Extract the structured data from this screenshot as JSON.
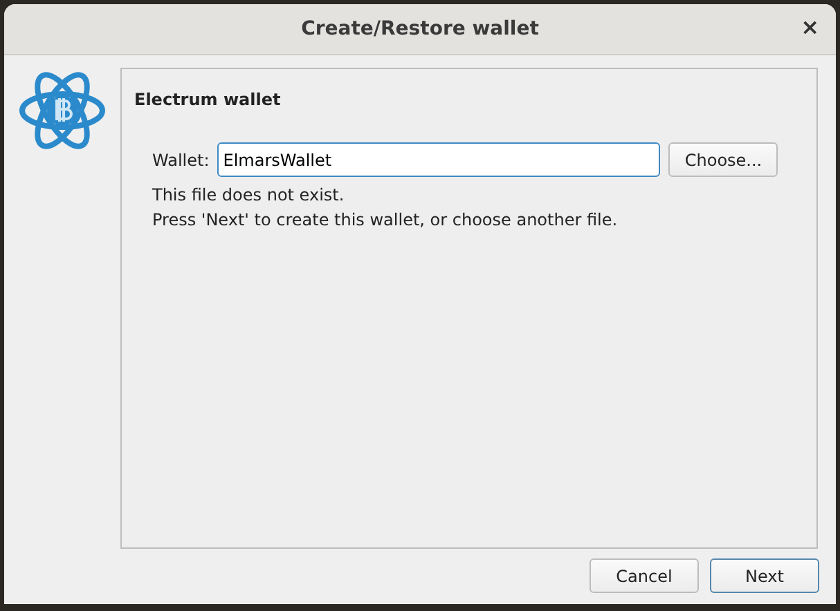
{
  "window": {
    "title": "Create/Restore wallet",
    "close": "×"
  },
  "panel": {
    "heading": "Electrum wallet",
    "field_label": "Wallet:",
    "field_value": "ElmarsWallet",
    "focused": true,
    "choose_button": "Choose...",
    "messages": [
      "This file does not exist.",
      "Press 'Next' to create this wallet, or choose another file."
    ]
  },
  "buttons": [
    {
      "label": "Cancel",
      "default": false
    },
    {
      "label": "Next",
      "default": true
    }
  ]
}
